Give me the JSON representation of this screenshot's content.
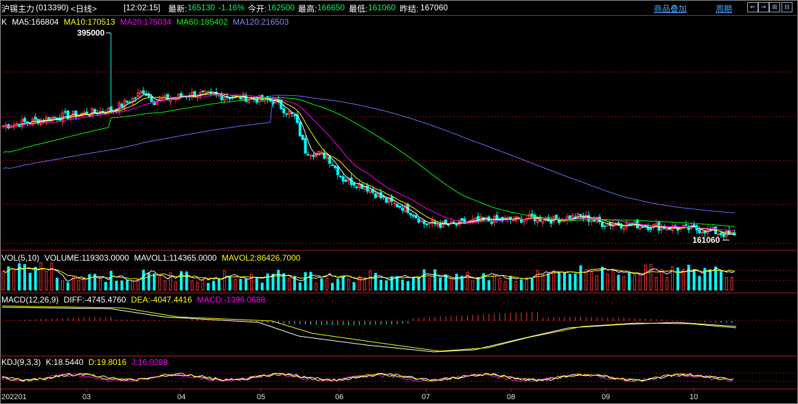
{
  "topbar": {
    "instrument": "沪锡主力",
    "code": "(013390)",
    "period_tag": "<日线>",
    "time": "[12:02:15]",
    "latest_label": "最新:",
    "latest_value": "165130",
    "change_pct": "-1.16%",
    "open_label": "今开:",
    "open_value": "162500",
    "high_label": "最高:",
    "high_value": "166650",
    "low_label": "最低:",
    "low_value": "161060",
    "prev_label": "昨结:",
    "prev_value": "167060",
    "overlay_link": "商品叠加",
    "period_link": "周期"
  },
  "colors": {
    "ma5": "#ffffff",
    "ma10": "#ffff00",
    "ma20": "#ff00ff",
    "ma60": "#00ff00",
    "ma120": "#6a6aff",
    "up": "#ff3333",
    "down": "#00ffff",
    "grid": "#8b0000"
  },
  "price_panel": {
    "label": "K",
    "ma5": "MA5:166804",
    "ma10": "MA10:170513",
    "ma20": "MA20:175034",
    "ma60": "MA60:185402",
    "ma120": "MA120:216503",
    "high_marker": "395000",
    "low_marker": "161060"
  },
  "volume_panel": {
    "label": "VOL(5,10)",
    "volume": "VOLUME:119303.0000",
    "mavol1": "MAVOL1:114365.0000",
    "mavol2": "MAVOL2:86426.7000"
  },
  "macd_panel": {
    "label": "MACD(12,26,9)",
    "diff": "DIFF:-4745.4760",
    "dea": "DEA:-4047.4416",
    "macd": "MACD:-1396.0688"
  },
  "kdj_panel": {
    "label": "KDJ(9,3,3)",
    "k": "K:18.5440",
    "d": "D:19.8016",
    "j": "J:16.0289"
  },
  "chart_data": {
    "type": "candlestick",
    "x_axis_labels": [
      "202201",
      "03",
      "04",
      "05",
      "06",
      "07",
      "08",
      "09",
      "10"
    ],
    "price_range": [
      161060,
      395000
    ],
    "key_points": [
      {
        "label": "2022-01 start",
        "close": 290000
      },
      {
        "label": "2022-03 peak",
        "high": 395000
      },
      {
        "label": "2022-04",
        "close": 340000
      },
      {
        "label": "2022-05",
        "close": 300000
      },
      {
        "label": "2022-06",
        "close": 250000
      },
      {
        "label": "2022-07",
        "close": 180000
      },
      {
        "label": "2022-08",
        "close": 187000
      },
      {
        "label": "2022-09",
        "close": 178000
      },
      {
        "label": "2022-10 end",
        "close": 165130
      }
    ],
    "moving_averages": [
      "MA5",
      "MA10",
      "MA20",
      "MA60",
      "MA120"
    ],
    "indicators": [
      "VOL(5,10)",
      "MACD(12,26,9)",
      "KDJ(9,3,3)"
    ]
  }
}
